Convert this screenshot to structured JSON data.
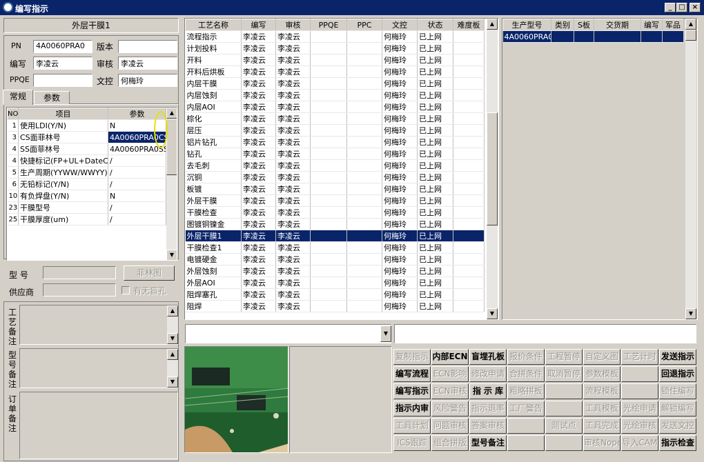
{
  "window": {
    "title": "编写指示",
    "min": "_",
    "max": "□",
    "close": "×"
  },
  "header": {
    "process_name": "外层干膜1"
  },
  "info": {
    "pn_label": "PN",
    "pn": "4A0060PRA0",
    "version_label": "版本",
    "version": "",
    "writer_label": "编写",
    "writer": "李凌云",
    "reviewer_label": "审核",
    "reviewer": "李凌云",
    "ppqe_label": "PPQE",
    "ppqe": "",
    "doc_label": "文控",
    "doc": "何梅玲"
  },
  "tabs": [
    "常规",
    "参数"
  ],
  "param_table": {
    "headers": [
      "NO",
      "项目",
      "参数"
    ],
    "rows": [
      [
        "1",
        "使用LDI(Y/N)",
        "N"
      ],
      [
        "3",
        "CS面菲林号",
        "4A0060PRA0CS"
      ],
      [
        "4",
        "SS面菲林号",
        "4A0060PRA0SS"
      ],
      [
        "4",
        "快捷标记(FP+UL+DateC",
        "/"
      ],
      [
        "5",
        "生产周期(YYWW/WWYY)",
        "/"
      ],
      [
        "6",
        "无铅标记(Y/N)",
        "/"
      ],
      [
        "10",
        "有负焊盘(Y/N)",
        "N"
      ],
      [
        "23",
        "干膜型号",
        "/"
      ],
      [
        "25",
        "干膜厚度(um)",
        "/"
      ]
    ]
  },
  "model": {
    "label": "型 号",
    "value": "",
    "film_button": "菲林图"
  },
  "supplier": {
    "label": "供应商",
    "value": "",
    "blind_hole_label": "有无盲孔"
  },
  "remarks": {
    "process": "工艺备注",
    "model": "型号备注",
    "order": "订单备注"
  },
  "process_table": {
    "headers": [
      "工艺名称",
      "编写",
      "审核",
      "PPQE",
      "PPC",
      "文控",
      "状态",
      "难度板"
    ],
    "selected": 18,
    "rows": [
      [
        "流程指示",
        "李凌云",
        "李凌云",
        "",
        "",
        "何梅玲",
        "已上网",
        ""
      ],
      [
        "计划投料",
        "李凌云",
        "李凌云",
        "",
        "",
        "何梅玲",
        "已上网",
        ""
      ],
      [
        "开料",
        "李凌云",
        "李凌云",
        "",
        "",
        "何梅玲",
        "已上网",
        ""
      ],
      [
        "开料后烘板",
        "李凌云",
        "李凌云",
        "",
        "",
        "何梅玲",
        "已上网",
        ""
      ],
      [
        "内层干膜",
        "李凌云",
        "李凌云",
        "",
        "",
        "何梅玲",
        "已上网",
        ""
      ],
      [
        "内层蚀刻",
        "李凌云",
        "李凌云",
        "",
        "",
        "何梅玲",
        "已上网",
        ""
      ],
      [
        "内层AOI",
        "李凌云",
        "李凌云",
        "",
        "",
        "何梅玲",
        "已上网",
        ""
      ],
      [
        "棕化",
        "李凌云",
        "李凌云",
        "",
        "",
        "何梅玲",
        "已上网",
        ""
      ],
      [
        "层压",
        "李凌云",
        "李凌云",
        "",
        "",
        "何梅玲",
        "已上网",
        ""
      ],
      [
        "铝片钻孔",
        "李凌云",
        "李凌云",
        "",
        "",
        "何梅玲",
        "已上网",
        ""
      ],
      [
        "钻孔",
        "李凌云",
        "李凌云",
        "",
        "",
        "何梅玲",
        "已上网",
        ""
      ],
      [
        "去毛刺",
        "李凌云",
        "李凌云",
        "",
        "",
        "何梅玲",
        "已上网",
        ""
      ],
      [
        "沉铜",
        "李凌云",
        "李凌云",
        "",
        "",
        "何梅玲",
        "已上网",
        ""
      ],
      [
        "板镀",
        "李凌云",
        "李凌云",
        "",
        "",
        "何梅玲",
        "已上网",
        ""
      ],
      [
        "外层干膜",
        "李凌云",
        "李凌云",
        "",
        "",
        "何梅玲",
        "已上网",
        ""
      ],
      [
        "干膜检查",
        "李凌云",
        "李凌云",
        "",
        "",
        "何梅玲",
        "已上网",
        ""
      ],
      [
        "图镀铜镍金",
        "李凌云",
        "李凌云",
        "",
        "",
        "何梅玲",
        "已上网",
        ""
      ],
      [
        "外层干膜1",
        "李凌云",
        "李凌云",
        "",
        "",
        "何梅玲",
        "已上网",
        ""
      ],
      [
        "干膜检查1",
        "李凌云",
        "李凌云",
        "",
        "",
        "何梅玲",
        "已上网",
        ""
      ],
      [
        "电镀硬金",
        "李凌云",
        "李凌云",
        "",
        "",
        "何梅玲",
        "已上网",
        ""
      ],
      [
        "外层蚀刻",
        "李凌云",
        "李凌云",
        "",
        "",
        "何梅玲",
        "已上网",
        ""
      ],
      [
        "外层AOI",
        "李凌云",
        "李凌云",
        "",
        "",
        "何梅玲",
        "已上网",
        ""
      ],
      [
        "阻焊塞孔",
        "李凌云",
        "李凌云",
        "",
        "",
        "何梅玲",
        "已上网",
        ""
      ],
      [
        "阻焊",
        "李凌云",
        "李凌云",
        "",
        "",
        "何梅玲",
        "已上网",
        ""
      ]
    ]
  },
  "product_table": {
    "headers": [
      "生产型号",
      "类别",
      "S板",
      "交货期",
      "编写",
      "军品"
    ],
    "rows": [
      [
        "4A0060PRA0",
        "",
        "",
        "",
        "",
        ""
      ]
    ]
  },
  "buttons": [
    [
      {
        "t": "复制指示",
        "e": false
      },
      {
        "t": "内部ECN",
        "e": true
      },
      {
        "t": "盲埋孔板",
        "e": true
      },
      {
        "t": "报价条件",
        "e": false
      },
      {
        "t": "工程暂停",
        "e": false
      },
      {
        "t": "自定义图",
        "e": false
      },
      {
        "t": "工艺计时",
        "e": false
      },
      {
        "t": "发送指示",
        "e": true
      }
    ],
    [
      {
        "t": "编写流程",
        "e": true
      },
      {
        "t": "ECN影响",
        "e": false
      },
      {
        "t": "修改申请",
        "e": false
      },
      {
        "t": "合拼条件",
        "e": false
      },
      {
        "t": "取消暂停",
        "e": false
      },
      {
        "t": "参数模板",
        "e": false
      },
      {
        "t": "",
        "e": false
      },
      {
        "t": "回退指示",
        "e": true
      }
    ],
    [
      {
        "t": "编写指示",
        "e": true
      },
      {
        "t": "ECN审核",
        "e": false
      },
      {
        "t": "指 示 库",
        "e": true
      },
      {
        "t": "粗略拼板",
        "e": false
      },
      {
        "t": "",
        "e": false
      },
      {
        "t": "流程模板",
        "e": false
      },
      {
        "t": "",
        "e": false
      },
      {
        "t": "锁住编写",
        "e": false
      }
    ],
    [
      {
        "t": "指示内审",
        "e": true
      },
      {
        "t": "风险警告",
        "e": false
      },
      {
        "t": "指示退率",
        "e": false
      },
      {
        "t": "工厂警告",
        "e": false
      },
      {
        "t": "",
        "e": false
      },
      {
        "t": "工具模板",
        "e": false
      },
      {
        "t": "光绘申请",
        "e": false
      },
      {
        "t": "解锁编写",
        "e": false
      }
    ],
    [
      {
        "t": "工具计划",
        "e": false
      },
      {
        "t": "问题审核",
        "e": false
      },
      {
        "t": "答案审核",
        "e": false
      },
      {
        "t": "",
        "e": false
      },
      {
        "t": "测试点",
        "e": false
      },
      {
        "t": "工具完成",
        "e": false
      },
      {
        "t": "光绘审核",
        "e": false
      },
      {
        "t": "发送文控",
        "e": false
      }
    ],
    [
      {
        "t": "ICS跟踪",
        "e": false
      },
      {
        "t": "组合拼版",
        "e": false
      },
      {
        "t": "型号备注",
        "e": true
      },
      {
        "t": "",
        "e": false
      },
      {
        "t": "",
        "e": false
      },
      {
        "t": "审核Nope",
        "e": false
      },
      {
        "t": "导入CAM",
        "e": false
      },
      {
        "t": "指示检查",
        "e": true
      }
    ]
  ]
}
